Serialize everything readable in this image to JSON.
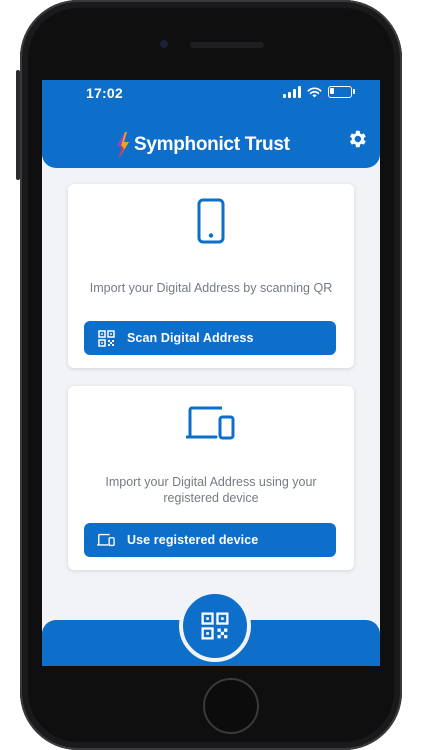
{
  "status_bar": {
    "time": "17:02"
  },
  "header": {
    "brand": "Symphonict Trust"
  },
  "cards": [
    {
      "description": "Import your Digital Address by scanning QR",
      "button_label": "Scan Digital Address",
      "icon": "phone-icon",
      "button_icon": "qr-code-icon"
    },
    {
      "description": "Import your Digital Address using your registered device",
      "button_label": "Use registered device",
      "icon": "devices-icon",
      "button_icon": "devices-icon"
    }
  ],
  "bottom_nav": {
    "center_icon": "qr-code-icon"
  },
  "colors": {
    "primary": "#0d6fc9",
    "background": "#f1f3f7",
    "text_muted": "#757b85"
  }
}
